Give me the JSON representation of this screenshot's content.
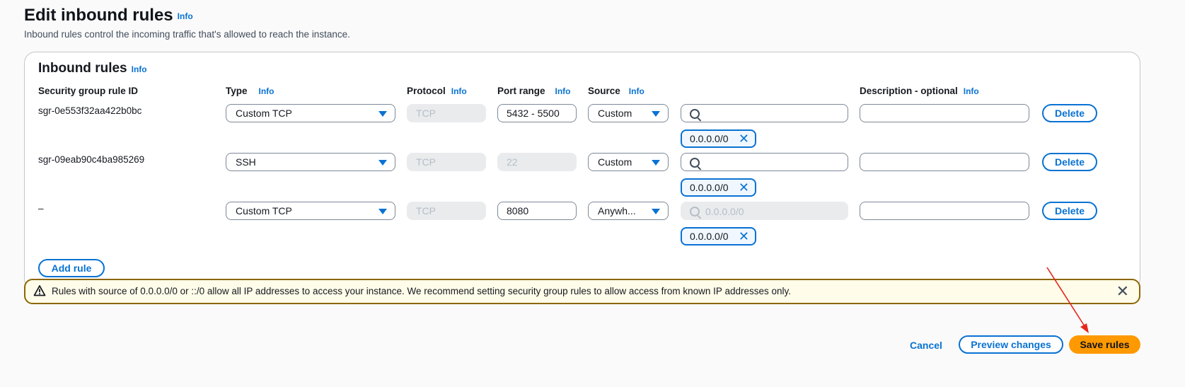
{
  "header": {
    "title": "Edit inbound rules",
    "info": "Info",
    "subtitle": "Inbound rules control the incoming traffic that's allowed to reach the instance."
  },
  "panel": {
    "title": "Inbound rules",
    "info": "Info",
    "columns": {
      "rule_id": "Security group rule ID",
      "type": "Type",
      "protocol": "Protocol",
      "port_range": "Port range",
      "source": "Source",
      "description": "Description - optional",
      "info": "Info"
    },
    "rows": [
      {
        "rule_id": "sgr-0e553f32aa422b0bc",
        "type": "Custom TCP",
        "protocol": "TCP",
        "port_range": "5432 - 5500",
        "source": "Custom",
        "search_value": "",
        "token": "0.0.0.0/0",
        "description": "",
        "delete": "Delete"
      },
      {
        "rule_id": "sgr-09eab90c4ba985269",
        "type": "SSH",
        "protocol": "TCP",
        "port_range": "22",
        "source": "Custom",
        "search_value": "",
        "token": "0.0.0.0/0",
        "description": "",
        "delete": "Delete"
      },
      {
        "rule_id": "–",
        "type": "Custom TCP",
        "protocol": "TCP",
        "port_range": "8080",
        "source": "Anywh...",
        "search_value": "0.0.0.0/0",
        "token": "0.0.0.0/0",
        "description": "",
        "delete": "Delete"
      }
    ],
    "add_rule": "Add rule"
  },
  "alert": {
    "message": "Rules with source of 0.0.0.0/0 or ::/0 allow all IP addresses to access your instance. We recommend setting security group rules to allow access from known IP addresses only."
  },
  "footer": {
    "cancel": "Cancel",
    "preview": "Preview changes",
    "save": "Save rules"
  },
  "colors": {
    "accent": "#0972d3",
    "primary_button": "#ff9900",
    "warning_border": "#8d6605",
    "warning_bg": "#fffce9",
    "annotation_arrow": "#e8261c"
  }
}
